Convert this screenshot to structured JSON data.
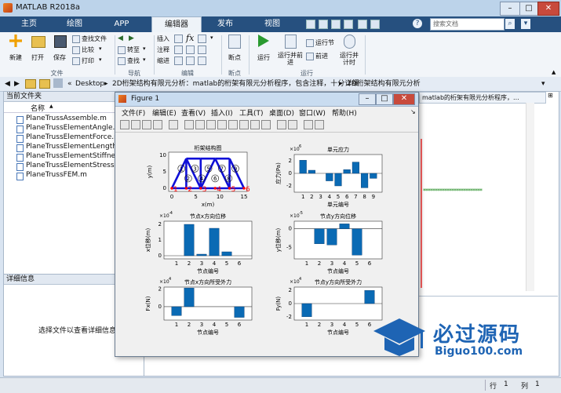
{
  "window": {
    "title": "MATLAB R2018a"
  },
  "tabs": [
    "主页",
    "绘图",
    "APP",
    "编辑器",
    "发布",
    "视图"
  ],
  "search_placeholder": "搜索文档",
  "ribbon": {
    "file": {
      "group": "文件",
      "new": "新建",
      "open": "打开",
      "save": "保存",
      "find_files": "查找文件",
      "compare": "比较",
      "print": "打印"
    },
    "navigate": {
      "group": "导航",
      "goto": "转至",
      "find": "查找"
    },
    "edit": {
      "group": "编辑",
      "insert": "插入",
      "comment": "注释",
      "indent": "缩进"
    },
    "breakpoints": {
      "group": "断点",
      "label": "断点"
    },
    "run": {
      "group": "运行",
      "run": "运行",
      "run_advance": "运行并前进",
      "run_section": "运行节",
      "advance": "前进",
      "run_time": "运行并计时"
    }
  },
  "address": {
    "parts": [
      "Desktop",
      "2D桁架结构有限元分析：matlab的桁架有限元分析程序，包含注释，十分详细",
      "2D桁架结构有限元分析"
    ]
  },
  "current_folder": {
    "title": "当前文件夹",
    "col_name": "名称",
    "sort_arrow": "▲",
    "files": [
      "PlaneTrussAssemble.m",
      "PlaneTrussElementAngle.m",
      "PlaneTrussElementForce.m",
      "PlaneTrussElementLength.m",
      "PlaneTrussElementStiffness.m",
      "PlaneTrussElementStress.m",
      "PlaneTrussFEM.m"
    ]
  },
  "details": {
    "title": "详细信息",
    "hint": "选择文件以查看详细信息"
  },
  "editor_tab": {
    "label": "matlab的桁架有限元分析程序，..."
  },
  "editor_asterisks": "*************************",
  "figure": {
    "title": "Figure 1",
    "menu": [
      "文件(F)",
      "编辑(E)",
      "查看(V)",
      "插入(I)",
      "工具(T)",
      "桌面(D)",
      "窗口(W)",
      "帮助(H)"
    ],
    "truss": {
      "title": "桁架结构图",
      "xlabel": "x(m)",
      "ylabel": "y(m)",
      "xticks": [
        "0",
        "5",
        "10",
        "15"
      ],
      "yticks": [
        "0",
        "5",
        "10"
      ],
      "bottom_nodes": [
        "1",
        "2",
        "3",
        "4",
        "5",
        "6"
      ],
      "elements": [
        "1",
        "2",
        "3",
        "4",
        "5",
        "6",
        "7",
        "8",
        "9"
      ]
    }
  },
  "chart_data": [
    {
      "type": "bar",
      "title": "单元应力",
      "ylabel": "应力(Pa)",
      "xlabel": "单元编号",
      "exp": "×10",
      "exp_sup": "6",
      "categories": [
        "1",
        "2",
        "3",
        "4",
        "5",
        "6",
        "7",
        "8",
        "9"
      ],
      "values": [
        2.1,
        0.5,
        0,
        -1.2,
        -2.0,
        0.6,
        1.8,
        -2.3,
        -0.8
      ],
      "ylim": [
        -3,
        3
      ],
      "yticks": [
        "-2",
        "0",
        "2"
      ]
    },
    {
      "type": "bar",
      "title": "节点x方向位移",
      "ylabel": "x位移(m)",
      "xlabel": "节点编号",
      "exp": "×10",
      "exp_sup": "-4",
      "categories": [
        "1",
        "2",
        "3",
        "4",
        "5",
        "6"
      ],
      "values": [
        0,
        2.0,
        0.1,
        1.75,
        0.25,
        0
      ],
      "ylim": [
        -0.2,
        2.2
      ],
      "yticks": [
        "0",
        "1",
        "2"
      ]
    },
    {
      "type": "bar",
      "title": "节点y方向位移",
      "ylabel": "y位移(m)",
      "xlabel": "节点编号",
      "exp": "×10",
      "exp_sup": "-5",
      "categories": [
        "1",
        "2",
        "3",
        "4",
        "5",
        "6"
      ],
      "values": [
        0,
        -4.0,
        -4.3,
        1.3,
        -7.0,
        0
      ],
      "ylim": [
        -8,
        2
      ],
      "yticks": [
        "-5",
        "0"
      ]
    },
    {
      "type": "bar",
      "title": "节点x方向所受外力",
      "ylabel": "Fx(N)",
      "xlabel": "节点编号",
      "exp": "×10",
      "exp_sup": "4",
      "categories": [
        "1",
        "2",
        "3",
        "4",
        "5",
        "6"
      ],
      "values": [
        -1.0,
        2.1,
        0,
        0,
        0,
        -1.2
      ],
      "ylim": [
        -1.5,
        2.2
      ],
      "yticks": [
        "0",
        "2"
      ]
    },
    {
      "type": "bar",
      "title": "节点y方向所受外力",
      "ylabel": "Fy(N)",
      "xlabel": "节点编号",
      "exp": "×10",
      "exp_sup": "4",
      "categories": [
        "1",
        "2",
        "3",
        "4",
        "5",
        "6"
      ],
      "values": [
        -2.0,
        0,
        0,
        0,
        0,
        2.0
      ],
      "ylim": [
        -2.5,
        2.5
      ],
      "yticks": [
        "-2",
        "0",
        "2"
      ]
    }
  ],
  "watermark": {
    "text": "必过源码",
    "url": "Biguo100.com"
  },
  "status": {
    "row_label": "行",
    "row": "1",
    "col_label": "列",
    "col": "1"
  },
  "colors": {
    "bar": "#0a6ab4",
    "truss_line": "#1010d8",
    "truss_mark": "#ff0000",
    "tabs_bg": "#26507f"
  }
}
